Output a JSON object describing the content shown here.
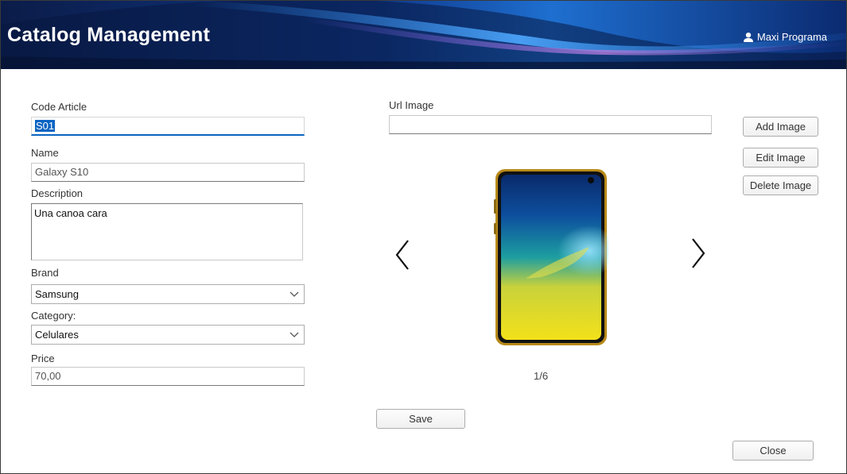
{
  "header": {
    "title": "Catalog Management",
    "user_name": "Maxi Programa"
  },
  "form": {
    "code_label": "Code Article",
    "code_value": "S01",
    "name_label": "Name",
    "name_value": "Galaxy S10",
    "description_label": "Description",
    "description_value": "Una canoa cara",
    "brand_label": "Brand",
    "brand_value": "Samsung",
    "category_label": "Category:",
    "category_value": "Celulares",
    "price_label": "Price",
    "price_value": "70,00"
  },
  "image_panel": {
    "url_label": "Url Image",
    "url_value": "",
    "add_label": "Add Image",
    "edit_label": "Edit Image",
    "delete_label": "Delete Image",
    "counter": "1/6"
  },
  "actions": {
    "save_label": "Save",
    "close_label": "Close"
  },
  "icons": {
    "user": "user-icon",
    "prev": "chevron-left-icon",
    "next": "chevron-right-icon",
    "dropdown": "chevron-down-icon"
  },
  "colors": {
    "header_bg": "#0a2a6e",
    "focus_accent": "#0a64c2"
  }
}
